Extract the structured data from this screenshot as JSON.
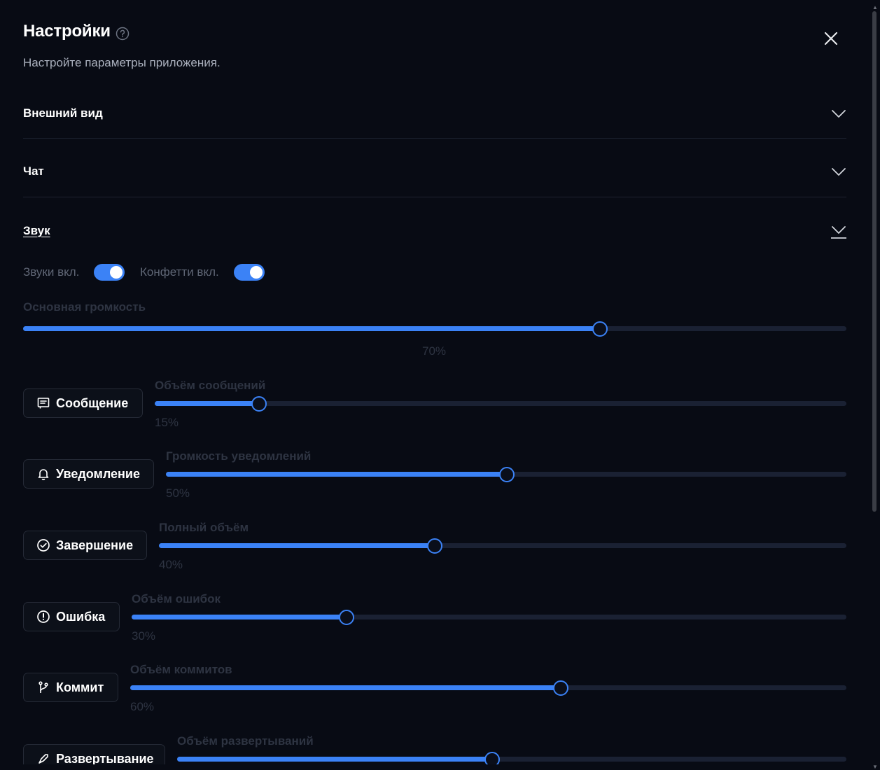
{
  "header": {
    "title": "Настройки",
    "subtitle": "Настройте параметры приложения."
  },
  "sections": {
    "appearance": "Внешний вид",
    "chat": "Чат",
    "sound": "Звук"
  },
  "sound": {
    "sounds_toggle": {
      "label": "Звуки вкл.",
      "on": true
    },
    "confetti_toggle": {
      "label": "Конфетти вкл.",
      "on": true
    },
    "master": {
      "label": "Основная громкость",
      "value": 70,
      "display": "70%"
    },
    "sounds": [
      {
        "button": "Сообщение",
        "icon": "message-icon",
        "label": "Объём сообщений",
        "value": 15,
        "display": "15%"
      },
      {
        "button": "Уведомление",
        "icon": "bell-icon",
        "label": "Громкость уведомлений",
        "value": 50,
        "display": "50%"
      },
      {
        "button": "Завершение",
        "icon": "check-circle-icon",
        "label": "Полный объём",
        "value": 40,
        "display": "40%"
      },
      {
        "button": "Ошибка",
        "icon": "alert-circle-icon",
        "label": "Объём ошибок",
        "value": 30,
        "display": "30%"
      },
      {
        "button": "Коммит",
        "icon": "git-branch-icon",
        "label": "Объём коммитов",
        "value": 60,
        "display": "60%"
      },
      {
        "button": "Развертывание",
        "icon": "rocket-icon",
        "label": "Объём развертываний",
        "value": 47
      }
    ]
  },
  "colors": {
    "accent": "#3b82f6",
    "background": "#080b14",
    "track": "#1a2133"
  }
}
